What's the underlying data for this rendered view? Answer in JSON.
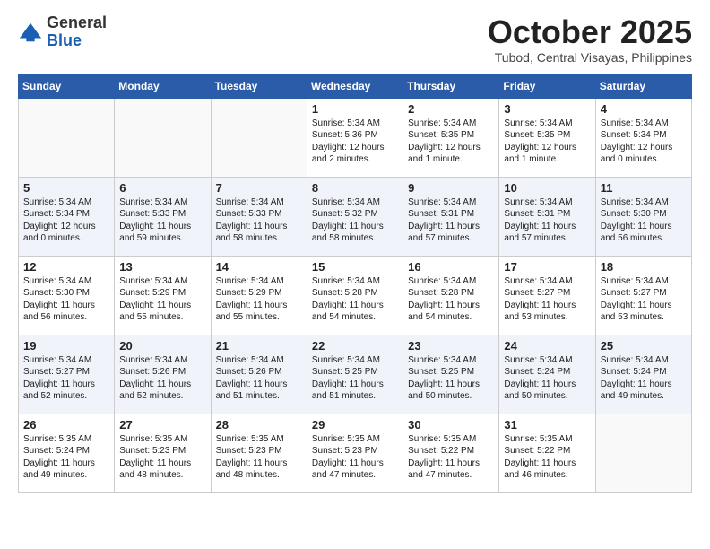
{
  "header": {
    "logo_general": "General",
    "logo_blue": "Blue",
    "month_title": "October 2025",
    "subtitle": "Tubod, Central Visayas, Philippines"
  },
  "weekdays": [
    "Sunday",
    "Monday",
    "Tuesday",
    "Wednesday",
    "Thursday",
    "Friday",
    "Saturday"
  ],
  "weeks": [
    [
      {
        "day": "",
        "info": ""
      },
      {
        "day": "",
        "info": ""
      },
      {
        "day": "",
        "info": ""
      },
      {
        "day": "1",
        "info": "Sunrise: 5:34 AM\nSunset: 5:36 PM\nDaylight: 12 hours\nand 2 minutes."
      },
      {
        "day": "2",
        "info": "Sunrise: 5:34 AM\nSunset: 5:35 PM\nDaylight: 12 hours\nand 1 minute."
      },
      {
        "day": "3",
        "info": "Sunrise: 5:34 AM\nSunset: 5:35 PM\nDaylight: 12 hours\nand 1 minute."
      },
      {
        "day": "4",
        "info": "Sunrise: 5:34 AM\nSunset: 5:34 PM\nDaylight: 12 hours\nand 0 minutes."
      }
    ],
    [
      {
        "day": "5",
        "info": "Sunrise: 5:34 AM\nSunset: 5:34 PM\nDaylight: 12 hours\nand 0 minutes."
      },
      {
        "day": "6",
        "info": "Sunrise: 5:34 AM\nSunset: 5:33 PM\nDaylight: 11 hours\nand 59 minutes."
      },
      {
        "day": "7",
        "info": "Sunrise: 5:34 AM\nSunset: 5:33 PM\nDaylight: 11 hours\nand 58 minutes."
      },
      {
        "day": "8",
        "info": "Sunrise: 5:34 AM\nSunset: 5:32 PM\nDaylight: 11 hours\nand 58 minutes."
      },
      {
        "day": "9",
        "info": "Sunrise: 5:34 AM\nSunset: 5:31 PM\nDaylight: 11 hours\nand 57 minutes."
      },
      {
        "day": "10",
        "info": "Sunrise: 5:34 AM\nSunset: 5:31 PM\nDaylight: 11 hours\nand 57 minutes."
      },
      {
        "day": "11",
        "info": "Sunrise: 5:34 AM\nSunset: 5:30 PM\nDaylight: 11 hours\nand 56 minutes."
      }
    ],
    [
      {
        "day": "12",
        "info": "Sunrise: 5:34 AM\nSunset: 5:30 PM\nDaylight: 11 hours\nand 56 minutes."
      },
      {
        "day": "13",
        "info": "Sunrise: 5:34 AM\nSunset: 5:29 PM\nDaylight: 11 hours\nand 55 minutes."
      },
      {
        "day": "14",
        "info": "Sunrise: 5:34 AM\nSunset: 5:29 PM\nDaylight: 11 hours\nand 55 minutes."
      },
      {
        "day": "15",
        "info": "Sunrise: 5:34 AM\nSunset: 5:28 PM\nDaylight: 11 hours\nand 54 minutes."
      },
      {
        "day": "16",
        "info": "Sunrise: 5:34 AM\nSunset: 5:28 PM\nDaylight: 11 hours\nand 54 minutes."
      },
      {
        "day": "17",
        "info": "Sunrise: 5:34 AM\nSunset: 5:27 PM\nDaylight: 11 hours\nand 53 minutes."
      },
      {
        "day": "18",
        "info": "Sunrise: 5:34 AM\nSunset: 5:27 PM\nDaylight: 11 hours\nand 53 minutes."
      }
    ],
    [
      {
        "day": "19",
        "info": "Sunrise: 5:34 AM\nSunset: 5:27 PM\nDaylight: 11 hours\nand 52 minutes."
      },
      {
        "day": "20",
        "info": "Sunrise: 5:34 AM\nSunset: 5:26 PM\nDaylight: 11 hours\nand 52 minutes."
      },
      {
        "day": "21",
        "info": "Sunrise: 5:34 AM\nSunset: 5:26 PM\nDaylight: 11 hours\nand 51 minutes."
      },
      {
        "day": "22",
        "info": "Sunrise: 5:34 AM\nSunset: 5:25 PM\nDaylight: 11 hours\nand 51 minutes."
      },
      {
        "day": "23",
        "info": "Sunrise: 5:34 AM\nSunset: 5:25 PM\nDaylight: 11 hours\nand 50 minutes."
      },
      {
        "day": "24",
        "info": "Sunrise: 5:34 AM\nSunset: 5:24 PM\nDaylight: 11 hours\nand 50 minutes."
      },
      {
        "day": "25",
        "info": "Sunrise: 5:34 AM\nSunset: 5:24 PM\nDaylight: 11 hours\nand 49 minutes."
      }
    ],
    [
      {
        "day": "26",
        "info": "Sunrise: 5:35 AM\nSunset: 5:24 PM\nDaylight: 11 hours\nand 49 minutes."
      },
      {
        "day": "27",
        "info": "Sunrise: 5:35 AM\nSunset: 5:23 PM\nDaylight: 11 hours\nand 48 minutes."
      },
      {
        "day": "28",
        "info": "Sunrise: 5:35 AM\nSunset: 5:23 PM\nDaylight: 11 hours\nand 48 minutes."
      },
      {
        "day": "29",
        "info": "Sunrise: 5:35 AM\nSunset: 5:23 PM\nDaylight: 11 hours\nand 47 minutes."
      },
      {
        "day": "30",
        "info": "Sunrise: 5:35 AM\nSunset: 5:22 PM\nDaylight: 11 hours\nand 47 minutes."
      },
      {
        "day": "31",
        "info": "Sunrise: 5:35 AM\nSunset: 5:22 PM\nDaylight: 11 hours\nand 46 minutes."
      },
      {
        "day": "",
        "info": ""
      }
    ]
  ]
}
